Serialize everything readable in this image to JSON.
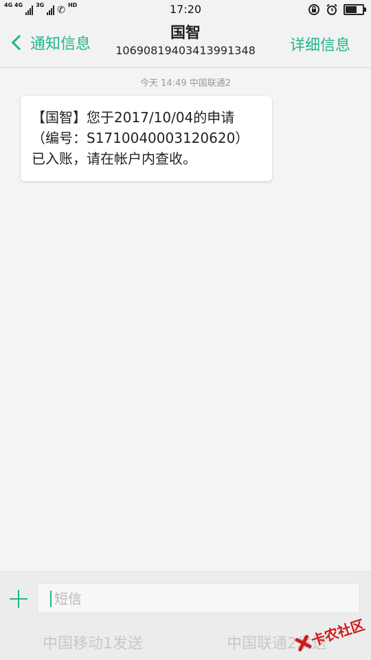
{
  "status_bar": {
    "sim1_label": "4G 4G",
    "sim2_label": "3G",
    "hd_label": "HD",
    "time": "17:20"
  },
  "header": {
    "back_label": "通知信息",
    "title": "国智",
    "number": "10690819403413991348",
    "detail_label": "详细信息"
  },
  "thread": {
    "meta": "今天 14:49  中国联通2",
    "messages": [
      "【国智】您于2017/10/04的申请（编号：S1710040003120620）已入账，请在帐户内查收。"
    ]
  },
  "compose": {
    "placeholder": "短信",
    "send_sim1": "中国移动1发送",
    "send_sim2": "中国联通2发送"
  },
  "watermark": {
    "text": "卡农社区"
  },
  "colors": {
    "accent": "#1fb58c",
    "watermark": "#d11a1a"
  }
}
